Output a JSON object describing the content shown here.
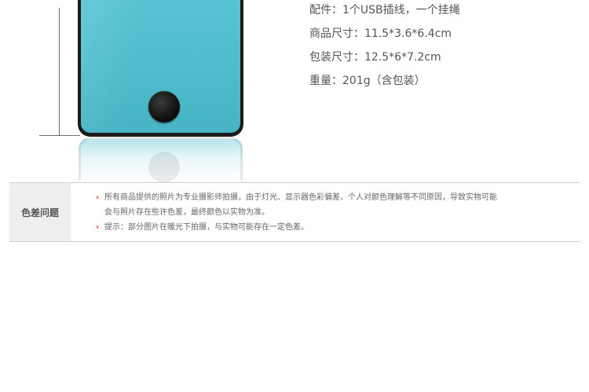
{
  "specs": {
    "accessories": "配件：1个USB插线，一个挂绳",
    "product_size": "商品尺寸：11.5*3.6*6.4cm",
    "package_size": "包装尺寸：12.5*6*7.2cm",
    "weight": "重量：201g（含包装）"
  },
  "notice": {
    "label": "色差问题",
    "bullet_icon": "chevron-right-icon",
    "bullet_glyph": "›",
    "accent_color": "#e0451b",
    "items": [
      {
        "line1": "所有商品提供的照片为专业摄影师拍摄，由于灯光、显示器色彩偏差、个人对颜色理解等不同原因，导致实物可能",
        "line2": "会与照片存在些许色差，最终颜色以实物为准。"
      },
      {
        "line1": "提示：部分图片在暖光下拍摄，与实物可能存在一定色差。"
      }
    ]
  },
  "product": {
    "device_color": "#4fbccb",
    "button_icon": "round-button-icon"
  }
}
